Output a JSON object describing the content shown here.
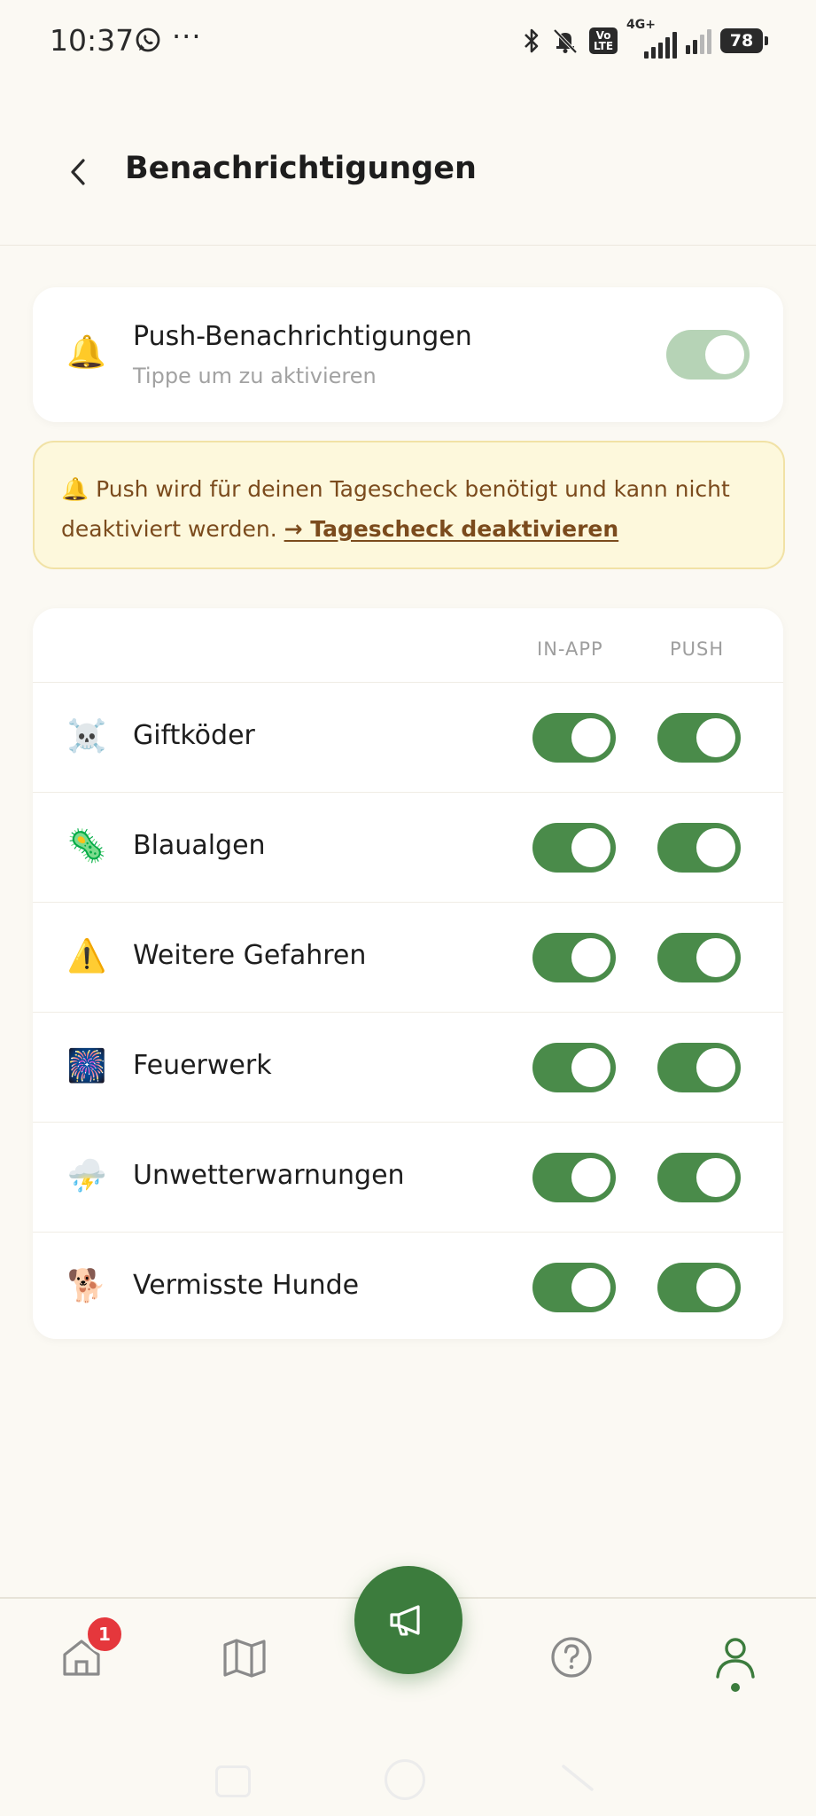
{
  "status_bar": {
    "time": "10:37",
    "volte": "Vo\nLTE",
    "network": "4G+",
    "battery": "78"
  },
  "header": {
    "title": "Benachrichtigungen"
  },
  "push_card": {
    "icon": "🔔",
    "title": "Push-Benachrichtigungen",
    "subtitle": "Tippe um zu aktivieren",
    "enabled": true
  },
  "notice": {
    "icon": "🔔",
    "text": "Push wird für deinen Tagescheck benötigt und kann nicht deaktiviert werden. ",
    "link_label": "→ Tagescheck deaktivieren"
  },
  "columns": {
    "in_app": "IN-APP",
    "push": "PUSH"
  },
  "categories": [
    {
      "icon": "☠️",
      "label": "Giftköder",
      "in_app": true,
      "push": true
    },
    {
      "icon": "🦠",
      "label": "Blaualgen",
      "in_app": true,
      "push": true
    },
    {
      "icon": "⚠️",
      "label": "Weitere Gefahren",
      "in_app": true,
      "push": true
    },
    {
      "icon": "🎆",
      "label": "Feuerwerk",
      "in_app": true,
      "push": true
    },
    {
      "icon": "⛈️",
      "label": "Unwetterwarnungen",
      "in_app": true,
      "push": true
    },
    {
      "icon": "🐕",
      "label": "Vermisste Hunde",
      "in_app": true,
      "push": true
    }
  ],
  "bottom_nav": {
    "home_badge": "1",
    "items": [
      "home-icon",
      "map-icon",
      "megaphone-icon",
      "help-icon",
      "profile-icon"
    ],
    "active": "profile-icon"
  },
  "colors": {
    "accent": "#4a8b4a",
    "accent_dark": "#3c7c3d",
    "badge": "#e5373c",
    "notice_bg": "#fdf8dc",
    "notice_text": "#7b4b1d"
  }
}
